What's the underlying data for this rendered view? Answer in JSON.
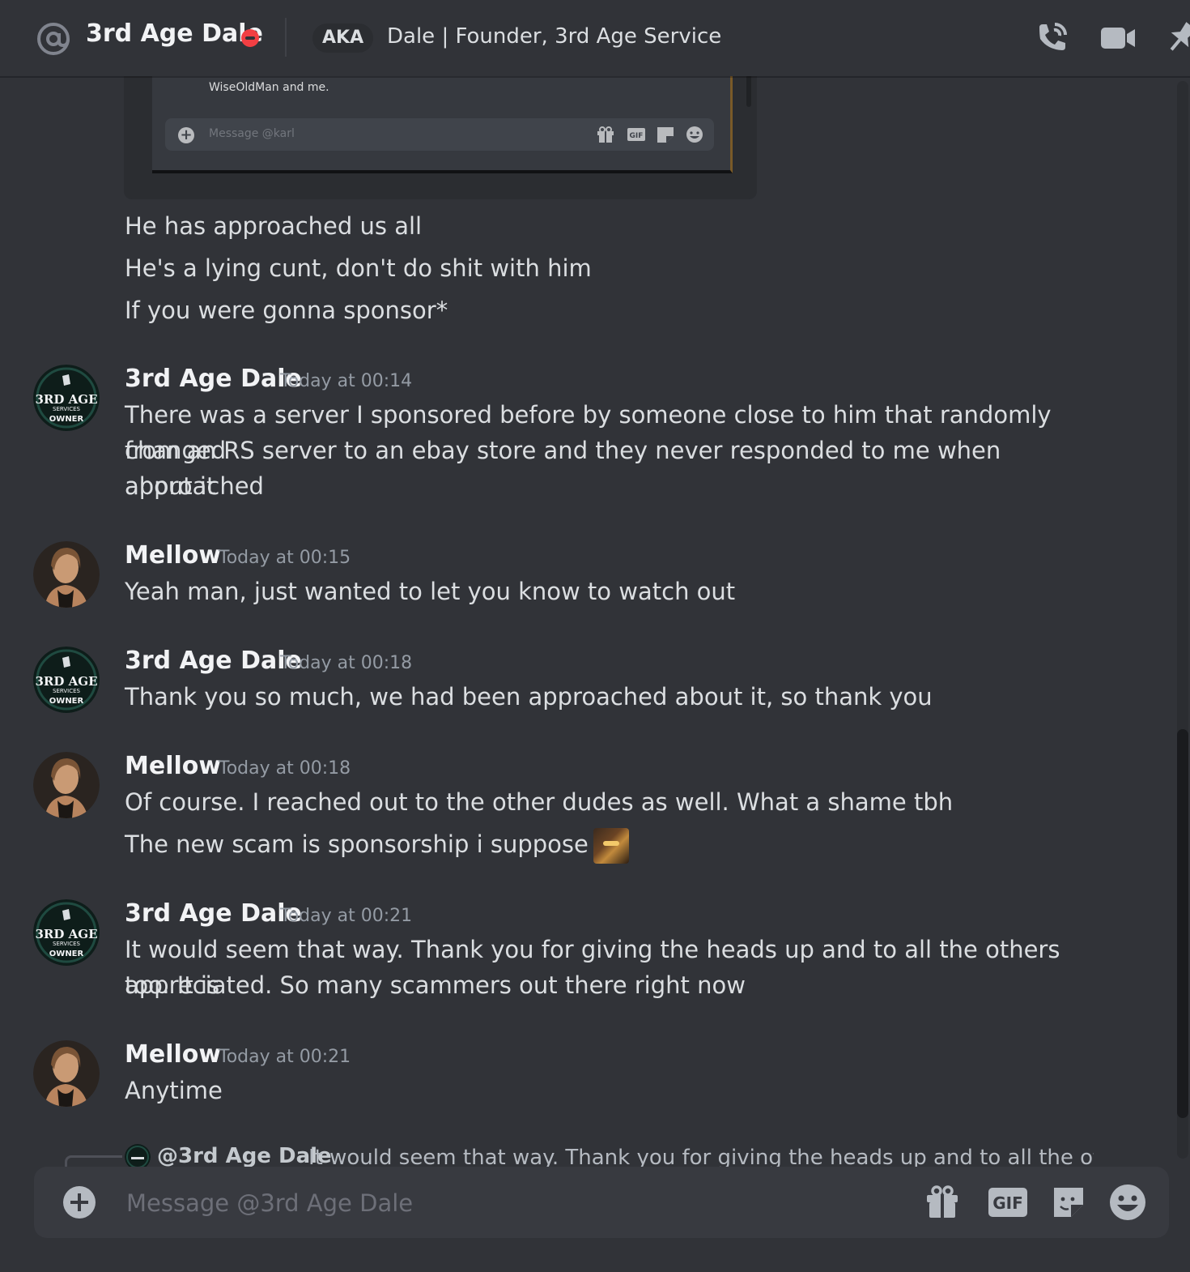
{
  "header": {
    "title": "3rd Age Dale",
    "aka_badge": "AKA",
    "aka_text": "Dale | Founder, 3rd Age Service",
    "icons": [
      "at-icon",
      "dnd-status-icon",
      "phone-call-icon",
      "video-call-icon",
      "pin-icon"
    ]
  },
  "embed": {
    "old_text": "WiseOldMan and me.",
    "mini_placeholder": "Message @karl",
    "mini_icons": [
      "gift-icon",
      "gif-icon",
      "sticker-icon",
      "emoji-icon"
    ]
  },
  "continued_messages": [
    "He has approached us all",
    "He's a lying cunt, don't do shit with him",
    "If you were gonna sponsor*"
  ],
  "messages": [
    {
      "author": "3rd Age Dale",
      "avatar": "3rd-age-owner-avatar",
      "avatar_text": [
        "3RD AGE",
        "SERVICES",
        "OWNER"
      ],
      "timestamp": "Today at 00:14",
      "lines": [
        "There was a server I sponsored before by someone close to him that randomly changed",
        "from an RS server to an ebay store and they never responded to me when approached",
        "about it"
      ]
    },
    {
      "author": "Mellow",
      "avatar": "mellow-avatar",
      "timestamp": "Today at 00:15",
      "lines": [
        "Yeah man, just wanted to let you know to watch out"
      ]
    },
    {
      "author": "3rd Age Dale",
      "avatar": "3rd-age-owner-avatar",
      "avatar_text": [
        "3RD AGE",
        "SERVICES",
        "OWNER"
      ],
      "timestamp": "Today at 00:18",
      "lines": [
        "Thank you so much, we had been approached about it, so thank you"
      ]
    },
    {
      "author": "Mellow",
      "avatar": "mellow-avatar",
      "timestamp": "Today at 00:18",
      "lines": [
        "Of course. I reached out to the other dudes as well. What a shame tbh",
        "The new scam is sponsorship i suppose"
      ],
      "custom_emoji": "sunglasses-emoji"
    },
    {
      "author": "3rd Age Dale",
      "avatar": "3rd-age-owner-avatar",
      "avatar_text": [
        "3RD AGE",
        "SERVICES",
        "OWNER"
      ],
      "timestamp": "Today at 00:21",
      "lines": [
        "It would seem that way. Thank you for giving the heads up and to all the others too. It is",
        "appreciated. So many scammers out there right now"
      ]
    },
    {
      "author": "Mellow",
      "avatar": "mellow-avatar",
      "timestamp": "Today at 00:21",
      "lines": [
        "Anytime"
      ]
    }
  ],
  "reply": {
    "mention": "@3rd Age Dale",
    "text": "It would seem that way. Thank you for giving the heads up and to all the others toc"
  },
  "composer": {
    "placeholder": "Message @3rd Age Dale",
    "icons": [
      "attach-plus-icon",
      "gift-icon",
      "gif-icon",
      "sticker-icon",
      "emoji-icon"
    ],
    "gif_label": "GIF"
  },
  "colors": {
    "background": "#313338",
    "text": "#dbdee1",
    "timestamp": "#949ba4",
    "dnd": "#f23f43",
    "composer": "#383a40"
  }
}
